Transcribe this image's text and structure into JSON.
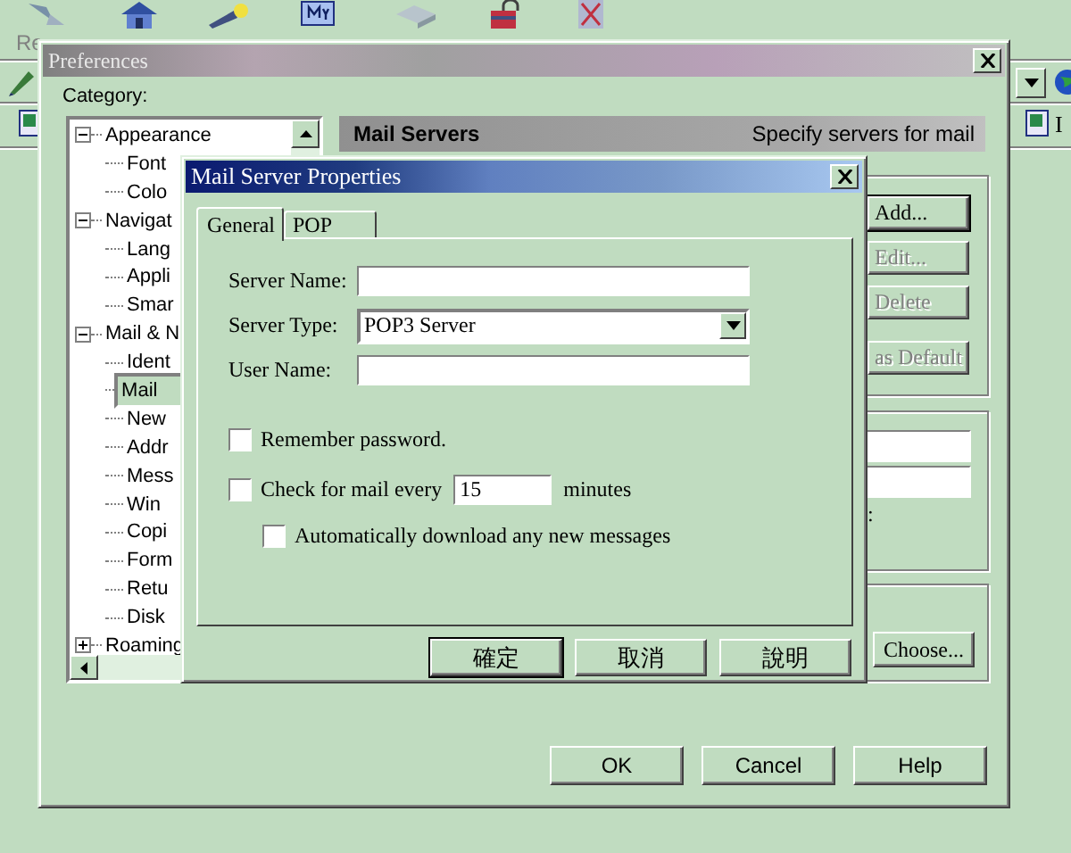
{
  "browser": {
    "toolbar_label": "Re",
    "side_label": "I"
  },
  "preferences": {
    "title": "Preferences",
    "category_label": "Category:",
    "tree": [
      {
        "label": "Appearance",
        "expanded": true,
        "selected": false,
        "children": [
          {
            "label": "Font",
            "selected": false
          },
          {
            "label": "Colo",
            "selected": false
          }
        ]
      },
      {
        "label": "Navigat",
        "expanded": true,
        "selected": false,
        "children": [
          {
            "label": "Lang",
            "selected": false
          },
          {
            "label": "Appli",
            "selected": false
          },
          {
            "label": "Smar",
            "selected": false
          }
        ]
      },
      {
        "label": "Mail & N",
        "expanded": true,
        "selected": false,
        "children": [
          {
            "label": "Ident",
            "selected": false
          },
          {
            "label": "Mail",
            "selected": true
          },
          {
            "label": "New",
            "selected": false
          },
          {
            "label": "Addr",
            "selected": false
          },
          {
            "label": "Mess",
            "selected": false
          },
          {
            "label": "Win",
            "selected": false
          },
          {
            "label": "Copi",
            "selected": false
          },
          {
            "label": "Form",
            "selected": false
          },
          {
            "label": "Retu",
            "selected": false
          },
          {
            "label": "Disk",
            "selected": false
          }
        ]
      },
      {
        "label": "Roaming",
        "expanded": false,
        "selected": false
      }
    ],
    "panel": {
      "title": "Mail Servers",
      "subtitle": "Specify servers for mail"
    },
    "server_buttons": [
      {
        "label": "Add...",
        "disabled": false
      },
      {
        "label": "Edit...",
        "disabled": true
      },
      {
        "label": "Delete",
        "disabled": true
      },
      {
        "label": "as Default",
        "disabled": true
      }
    ],
    "label_fragment": ":",
    "choose_button": {
      "label": "Choose..."
    },
    "buttons": [
      {
        "label": "OK"
      },
      {
        "label": "Cancel"
      },
      {
        "label": "Help"
      }
    ]
  },
  "dialog": {
    "title": "Mail Server Properties",
    "tabs": [
      {
        "label": "General",
        "selected": true
      },
      {
        "label": "POP",
        "selected": false
      }
    ],
    "fields": [
      {
        "kind": "text",
        "label": "Server Name:"
      },
      {
        "kind": "select",
        "label": "Server Type:",
        "value": "POP3 Server"
      },
      {
        "kind": "text",
        "label": "User Name:"
      }
    ],
    "options": [
      {
        "label": "Remember password.",
        "checked": false
      },
      {
        "label": "Check for mail every",
        "checked": false,
        "value": "15",
        "unit": "minutes",
        "children": [
          {
            "label": "Automatically download any new messages",
            "checked": false
          }
        ]
      }
    ],
    "buttons": [
      "確定",
      "取消",
      "說明"
    ]
  }
}
